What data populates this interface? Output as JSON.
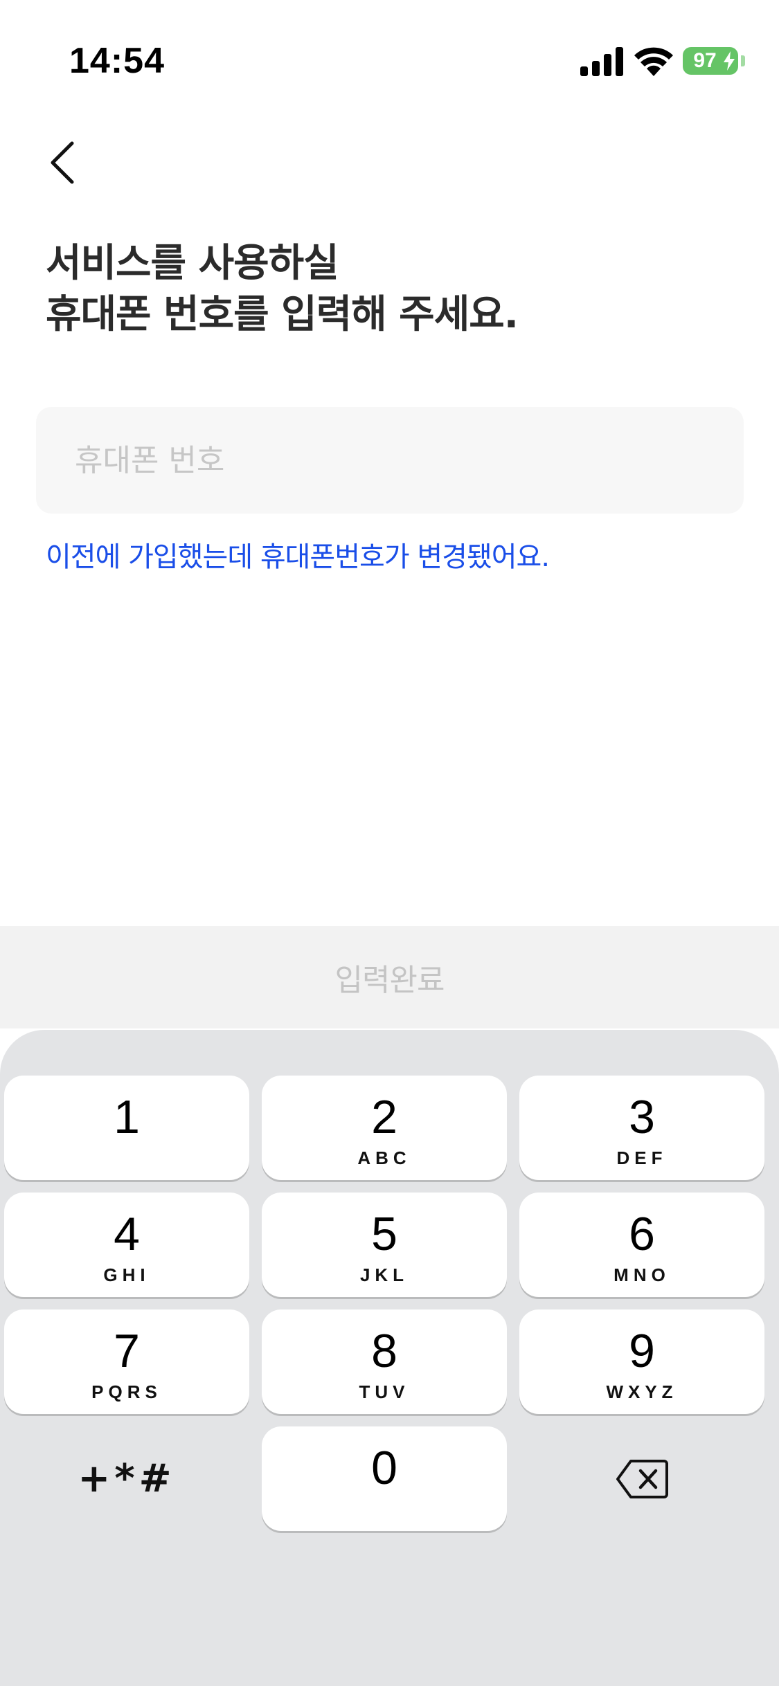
{
  "status_bar": {
    "time": "14:54",
    "battery": "97",
    "battery_color": "#65c466",
    "icons": [
      "signal-icon",
      "wifi-icon",
      "battery-icon"
    ]
  },
  "header": {
    "back_icon": "chevron-left-icon"
  },
  "title": {
    "line1": "서비스를 사용하실",
    "line2": "휴대폰 번호를 입력해 주세요."
  },
  "phone_input": {
    "value": "",
    "placeholder": "휴대폰 번호"
  },
  "changed_link": "이전에 가입했는데 휴대폰번호가 변경됐어요.",
  "submit": {
    "label": "입력완료"
  },
  "keyboard": {
    "keys": [
      {
        "digit": "1",
        "letters": ""
      },
      {
        "digit": "2",
        "letters": "ABC"
      },
      {
        "digit": "3",
        "letters": "DEF"
      },
      {
        "digit": "4",
        "letters": "GHI"
      },
      {
        "digit": "5",
        "letters": "JKL"
      },
      {
        "digit": "6",
        "letters": "MNO"
      },
      {
        "digit": "7",
        "letters": "PQRS"
      },
      {
        "digit": "8",
        "letters": "TUV"
      },
      {
        "digit": "9",
        "letters": "WXYZ"
      },
      {
        "digit": "0",
        "letters": ""
      }
    ],
    "symbols": "+*#",
    "delete_icon": "backspace-icon"
  },
  "colors": {
    "link": "#1a4ee8",
    "keyboard_bg": "#e3e4e6",
    "submit_bg": "#f2f2f2"
  }
}
